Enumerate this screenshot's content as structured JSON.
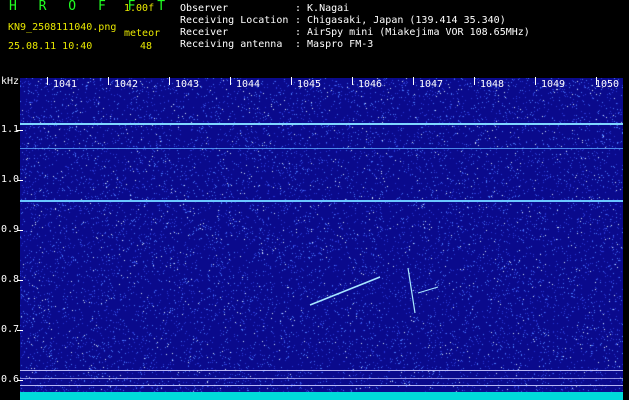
{
  "header": {
    "logo": "H R O F F T",
    "version": "1.00f",
    "filename": "KN9_2508111040.png",
    "mode": "meteor",
    "datetime": "25.08.11 10:40",
    "count": "48",
    "rows": [
      {
        "label": "Observer",
        "value": ": K.Nagai"
      },
      {
        "label": "Receiving Location",
        "value": ": Chigasaki, Japan (139.414 35.340)"
      },
      {
        "label": "Receiver",
        "value": ": AirSpy mini (Miakejima VOR 108.65MHz)"
      },
      {
        "label": "Receiving antenna",
        "value": ": Maspro FM-3"
      }
    ]
  },
  "axes": {
    "y_unit": "kHz",
    "y_ticks": [
      "1.1",
      "1.0",
      "0.9",
      "0.8",
      "0.7",
      "0.6"
    ],
    "x_ticks": [
      "1041",
      "1042",
      "1043",
      "1044",
      "1045",
      "1046",
      "1047",
      "1048",
      "1049",
      "1050"
    ]
  },
  "colors": {
    "background": "#0a0a8c",
    "signal": "#7fd6ff",
    "header_text": "#ffffff",
    "header_accent": "#e8e800",
    "logo": "#22ff22",
    "baseline": "#00dada"
  }
}
